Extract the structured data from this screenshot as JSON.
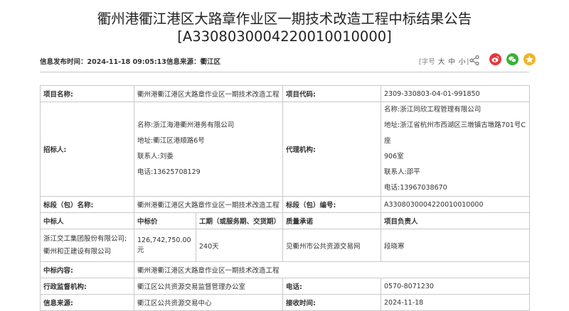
{
  "title": {
    "line1": "衢州港衢江港区大路章作业区一期技术改造工程中标结果公告",
    "line2": "[A3308030004220010010000]"
  },
  "meta": {
    "publish_label": "信息发布时间：",
    "publish_time": "2024-11-18 09:05:13",
    "source_label": "信息来源：",
    "source_value": "衢江区",
    "font_size_open": "[字号",
    "font_large": "大",
    "font_medium": "中",
    "font_small": "小",
    "font_size_close": "]"
  },
  "colors": {
    "label_blue": "#1a63b5",
    "weibo": "#e4393c",
    "wechat": "#3cb035",
    "qzone": "#f0b424"
  },
  "table": {
    "project_name_label": "项目名称:",
    "project_name": "衢州港衢江港区大路章作业区一期技术改造工程",
    "project_code_label": "项目代码:",
    "project_code": "2309-330803-04-01-991850",
    "tenderer_label": "招标人:",
    "tenderer_lines": [
      "名称:浙江海港衢州港务有限公司",
      "地址:衢江区港顺路6号",
      "联系人:刘委",
      "电话:13625708129"
    ],
    "agency_label": "代理机构:",
    "agency_lines": [
      "名称:浙江同欣工程管理有限公司",
      "地址:浙江省杭州市西湖区三墩镇古墩路701号C座",
      "906室",
      "联系人:邵平",
      "电话:13967038670"
    ],
    "section_name_label": "标段（包）名称:",
    "section_name": "衢州港衢江港区大路章作业区一期技术改造工程",
    "section_code_label": "标段（包）编号:",
    "section_code": "A3308030004220010010000",
    "headers": {
      "winner": "中标人",
      "price": "中标价",
      "duration": "工期（或服务期、交货期）",
      "quality": "质量承诺",
      "manager": "项目负责人"
    },
    "winner": "浙江交工集团股份有限公司;衢州和正建设有限公司",
    "price": "126,742,750.00元",
    "duration": "240天",
    "quality": "见衢州市公共资源交易网",
    "manager": "段晓寒",
    "content_label": "中标内容:",
    "content": "衢州港衢江港区大路章作业区一期技术改造工程",
    "supervisor_label": "行政监督机构:",
    "supervisor": "衢江区公共资源交易监督管理办公室",
    "phone_label": "电话:",
    "phone": "0570-8071230",
    "info_source_label": "信息来源:",
    "info_source": "衢江区公共资源交易中心",
    "receive_time_label": "接收时间:",
    "receive_time": "2024-11-18"
  }
}
